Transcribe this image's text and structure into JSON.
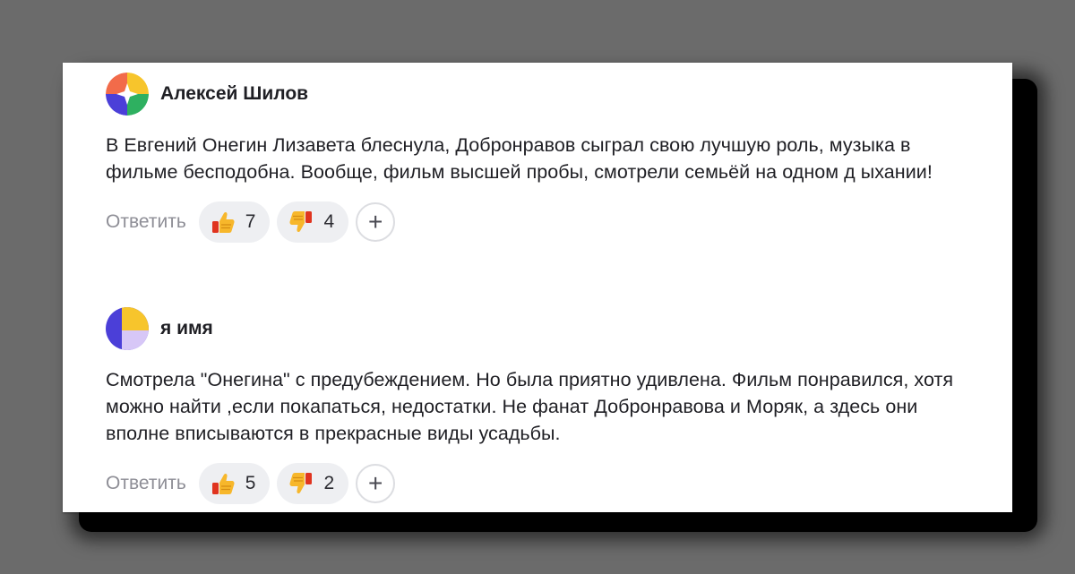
{
  "comments": [
    {
      "author": "Алексей Шилов",
      "text": "В Евгений Онегин Лизавета блеснула, Добронравов сыграл свою лучшую роль, музыка в фильме бесподобна. Вообще, фильм высшей пробы, смотрели семьёй на одном д ыхании!",
      "reply_label": "Ответить",
      "likes": "7",
      "dislikes": "4",
      "add_label": "+",
      "avatar_icon": "avatar-multicolor-icon"
    },
    {
      "author": "я имя",
      "text": "Смотрела \"Онегина\" с предубеждением. Но была приятно удивлена. Фильм понравился, хотя можно найти ,если покапаться, недостатки. Не фанат Добронравова и Моряк, а здесь они вполне вписываются в прекрасные виды усадьбы.",
      "reply_label": "Ответить",
      "likes": "5",
      "dislikes": "2",
      "add_label": "+",
      "avatar_icon": "avatar-yellow-purple-icon"
    }
  ],
  "colors": {
    "background": "#6b6b6b",
    "card": "#ffffff",
    "text": "#1f1f24",
    "muted": "#8e8e96",
    "pill": "#eeeff2",
    "thumb_yellow": "#f7b72b",
    "thumb_red": "#e0341f"
  }
}
